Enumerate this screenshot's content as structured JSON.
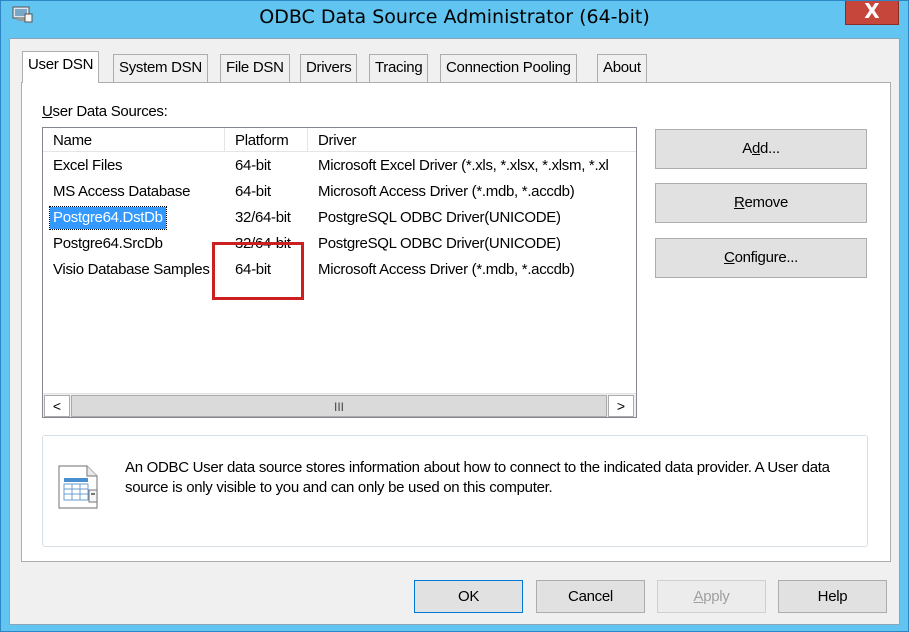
{
  "window": {
    "title": "ODBC Data Source Administrator (64-bit)",
    "close_glyph": "X",
    "icon": "odbc-admin-icon"
  },
  "tabs": [
    {
      "label": "User DSN",
      "active": true
    },
    {
      "label": "System DSN"
    },
    {
      "label": "File DSN"
    },
    {
      "label": "Drivers"
    },
    {
      "label": "Tracing"
    },
    {
      "label": "Connection Pooling"
    },
    {
      "label": "About"
    }
  ],
  "user_dsn": {
    "section_label_prefix": "U",
    "section_label_rest": "ser Data Sources:",
    "columns": [
      "Name",
      "Platform",
      "Driver"
    ],
    "rows": [
      {
        "name": "Excel Files",
        "platform": "64-bit",
        "driver": "Microsoft Excel Driver (*.xls, *.xlsx, *.xlsm, *.xl"
      },
      {
        "name": "MS Access Database",
        "platform": "64-bit",
        "driver": "Microsoft Access Driver (*.mdb, *.accdb)"
      },
      {
        "name": "Postgre64.DstDb",
        "platform": "32/64-bit",
        "driver": "PostgreSQL ODBC Driver(UNICODE)",
        "selected": true
      },
      {
        "name": "Postgre64.SrcDb",
        "platform": "32/64-bit",
        "driver": "PostgreSQL ODBC Driver(UNICODE)"
      },
      {
        "name": "Visio Database Samples",
        "platform": "64-bit",
        "driver": "Microsoft Access Driver (*.mdb, *.accdb)"
      }
    ],
    "scrollbar": {
      "left_arrow": "<",
      "right_arrow": ">",
      "thumb_grip": "III"
    },
    "buttons": {
      "add": {
        "pre": "A",
        "ul": "d",
        "post": "d..."
      },
      "remove": {
        "pre": "",
        "ul": "R",
        "post": "emove"
      },
      "configure": {
        "pre": "",
        "ul": "C",
        "post": "onfigure..."
      }
    },
    "info_text": "An ODBC User data source stores information about how to connect to the indicated data provider.   A User data source is only visible to you and can only be used on this computer.",
    "info_icon": "data-source-icon"
  },
  "dialog_buttons": {
    "ok": "OK",
    "cancel": "Cancel",
    "apply_ul": "A",
    "apply_rest": "pply",
    "help": "Help"
  },
  "colors": {
    "titlebar": "#62c4f0",
    "selection": "#3399ff",
    "highlight_box": "#cc1f1f",
    "close_button": "#c7463c"
  }
}
